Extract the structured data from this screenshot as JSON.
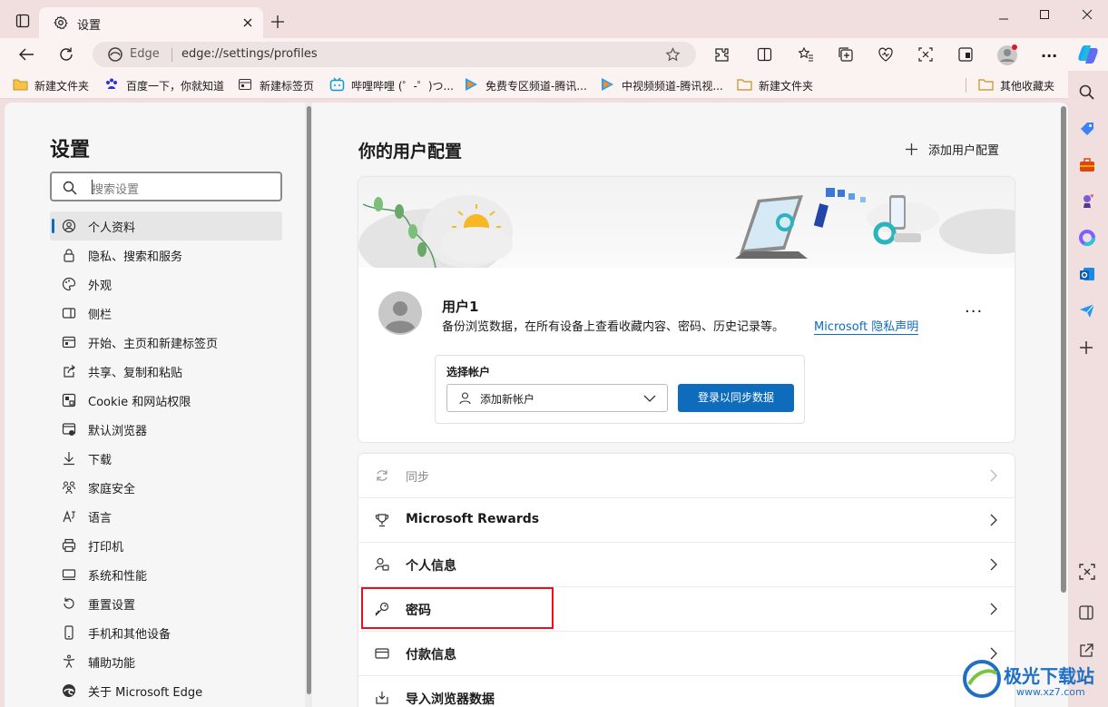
{
  "window": {
    "tab_title": "设置"
  },
  "address": {
    "site": "Edge",
    "url": "edge://settings/profiles"
  },
  "bookmarks": [
    {
      "label": "新建文件夹",
      "icon": "folder-icon"
    },
    {
      "label": "百度一下，你就知道",
      "icon": "baidu-paw-icon"
    },
    {
      "label": "新建标签页",
      "icon": "newtab-icon"
    },
    {
      "label": "哔哩哔哩 (゜-゜)つ...",
      "icon": "bilibili-icon"
    },
    {
      "label": "免费专区频道-腾讯...",
      "icon": "tencent-video-icon"
    },
    {
      "label": "中视频频道-腾讯视...",
      "icon": "tencent-video-icon"
    },
    {
      "label": "新建文件夹",
      "icon": "folder-icon"
    },
    {
      "label": "其他收藏夹",
      "icon": "folder-icon"
    }
  ],
  "settings": {
    "title": "设置",
    "search_placeholder": "搜索设置",
    "nav": [
      {
        "label": "个人资料",
        "icon": "profile-icon",
        "active": true
      },
      {
        "label": "隐私、搜索和服务",
        "icon": "lock-icon"
      },
      {
        "label": "外观",
        "icon": "palette-icon"
      },
      {
        "label": "侧栏",
        "icon": "sidebar-icon"
      },
      {
        "label": "开始、主页和新建标签页",
        "icon": "home-tab-icon"
      },
      {
        "label": "共享、复制和粘贴",
        "icon": "share-icon"
      },
      {
        "label": "Cookie 和网站权限",
        "icon": "cookie-icon"
      },
      {
        "label": "默认浏览器",
        "icon": "browser-icon"
      },
      {
        "label": "下载",
        "icon": "download-icon"
      },
      {
        "label": "家庭安全",
        "icon": "family-icon"
      },
      {
        "label": "语言",
        "icon": "language-icon"
      },
      {
        "label": "打印机",
        "icon": "printer-icon"
      },
      {
        "label": "系统和性能",
        "icon": "system-icon"
      },
      {
        "label": "重置设置",
        "icon": "reset-icon"
      },
      {
        "label": "手机和其他设备",
        "icon": "phone-icon"
      },
      {
        "label": "辅助功能",
        "icon": "accessibility-icon"
      },
      {
        "label": "关于 Microsoft Edge",
        "icon": "edge-icon"
      }
    ]
  },
  "main": {
    "title": "你的用户配置",
    "add_profile": "添加用户配置",
    "profile": {
      "name": "用户1",
      "description": "备份浏览数据，在所有设备上查看收藏内容、密码、历史记录等。",
      "privacy_link": "Microsoft 隐私声明",
      "choose_account": "选择帐户",
      "account_select": "添加新帐户",
      "signin_button": "登录以同步数据"
    },
    "rows": [
      {
        "label": "同步",
        "icon": "sync-icon",
        "disabled": true
      },
      {
        "label": "Microsoft Rewards",
        "icon": "trophy-icon"
      },
      {
        "label": "个人信息",
        "icon": "person-info-icon"
      },
      {
        "label": "密码",
        "icon": "key-icon",
        "highlighted": true
      },
      {
        "label": "付款信息",
        "icon": "card-icon"
      },
      {
        "label": "导入浏览器数据",
        "icon": "import-icon"
      }
    ]
  },
  "watermark": {
    "title": "极光下载站",
    "url": "www.xz7.com"
  },
  "colors": {
    "accent": "#0f6cbd",
    "highlight": "#e81123",
    "titlebar": "#f1dede"
  }
}
